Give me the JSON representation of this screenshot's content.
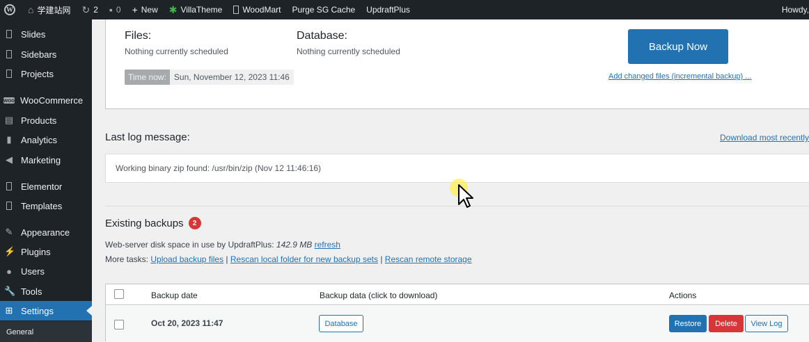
{
  "admin_bar": {
    "site_name": "学建站网",
    "updates_count": "2",
    "comments_count": "0",
    "new_label": "New",
    "items": [
      "VillaTheme",
      "WoodMart",
      "Purge SG Cache",
      "UpdraftPlus"
    ],
    "howdy": "Howdy, "
  },
  "sidebar": {
    "items": [
      {
        "label": "Slides",
        "icon": "box-icon"
      },
      {
        "label": "Sidebars",
        "icon": "box-icon"
      },
      {
        "label": "Projects",
        "icon": "box-icon"
      },
      {
        "label": "WooCommerce",
        "icon": "woo-icon"
      },
      {
        "label": "Products",
        "icon": "archive-icon"
      },
      {
        "label": "Analytics",
        "icon": "chart-bars-icon"
      },
      {
        "label": "Marketing",
        "icon": "megaphone-icon"
      },
      {
        "label": "Elementor",
        "icon": "box-icon"
      },
      {
        "label": "Templates",
        "icon": "box-icon"
      },
      {
        "label": "Appearance",
        "icon": "brush-icon"
      },
      {
        "label": "Plugins",
        "icon": "plug-icon"
      },
      {
        "label": "Users",
        "icon": "user-icon"
      },
      {
        "label": "Tools",
        "icon": "wrench-icon"
      },
      {
        "label": "Settings",
        "icon": "settings-icon"
      }
    ],
    "active": "Settings",
    "submenu_first": "General"
  },
  "schedule": {
    "files_label": "Files:",
    "files_status": "Nothing currently scheduled",
    "database_label": "Database:",
    "database_status": "Nothing currently scheduled",
    "time_now_label": "Time now:",
    "time_now_value": "Sun, November 12, 2023 11:46",
    "backup_now_label": "Backup Now",
    "incremental_link": "Add changed files (incremental backup) ..."
  },
  "log": {
    "title": "Last log message:",
    "download_link": "Download most recently",
    "message": "Working binary zip found: /usr/bin/zip (Nov 12 11:46:16)"
  },
  "existing_backups": {
    "title": "Existing backups",
    "count": "2",
    "disk_label": "Web-server disk space in use by UpdraftPlus:",
    "disk_value": "142.9 MB",
    "refresh_link": "refresh",
    "more_tasks_label": "More tasks:",
    "task_upload": "Upload backup files",
    "task_rescan_local": "Rescan local folder for new backup sets",
    "task_rescan_remote": "Rescan remote storage",
    "separator": " | ",
    "columns": {
      "date": "Backup date",
      "data": "Backup data (click to download)",
      "actions": "Actions"
    },
    "rows": [
      {
        "date": "Oct 20, 2023 11:47",
        "data_button": "Database",
        "restore": "Restore",
        "delete": "Delete",
        "view_log": "View Log"
      }
    ]
  },
  "colors": {
    "primary": "#2271b1",
    "danger": "#d63638",
    "admin_dark": "#1d2327"
  }
}
